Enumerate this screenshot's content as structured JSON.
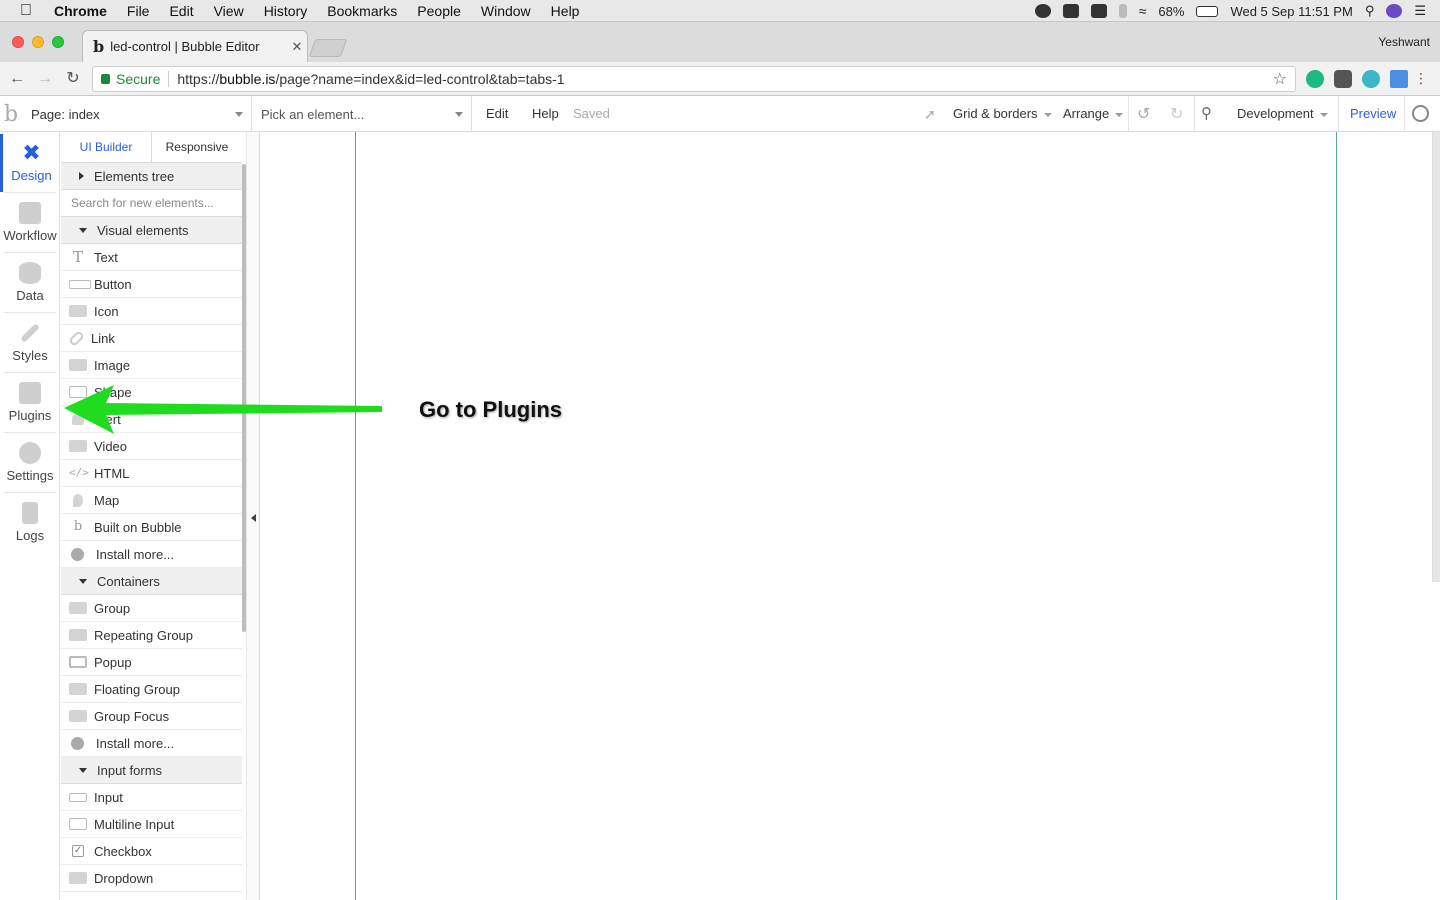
{
  "menubar": {
    "app": "Chrome",
    "items": [
      "File",
      "Edit",
      "View",
      "History",
      "Bookmarks",
      "People",
      "Window",
      "Help"
    ],
    "battery": "68%",
    "datetime": "Wed 5 Sep  11:51 PM"
  },
  "browser": {
    "tab_title": "led-control | Bubble Editor",
    "tab_favicon": "b",
    "profile_name": "Yeshwant",
    "secure_label": "Secure",
    "url_scheme": "https://",
    "url_host": "bubble.is",
    "url_path": "/page?name=index&id=led-control&tab=tabs-1"
  },
  "editor_header": {
    "logo": "b",
    "page_selector": "Page: index",
    "element_picker_placeholder": "Pick an element...",
    "edit": "Edit",
    "help": "Help",
    "status": "Saved",
    "grid_borders": "Grid & borders",
    "arrange": "Arrange",
    "environment": "Development",
    "preview": "Preview"
  },
  "rail": [
    {
      "label": "Design",
      "icon": "design-icon",
      "active": true
    },
    {
      "label": "Workflow",
      "icon": "workflow-icon"
    },
    {
      "label": "Data",
      "icon": "database-icon"
    },
    {
      "label": "Styles",
      "icon": "brush-icon"
    },
    {
      "label": "Plugins",
      "icon": "plugins-icon"
    },
    {
      "label": "Settings",
      "icon": "gear-icon"
    },
    {
      "label": "Logs",
      "icon": "document-icon"
    }
  ],
  "panel": {
    "tabs": [
      "UI Builder",
      "Responsive"
    ],
    "elements_tree": "Elements tree",
    "search_placeholder": "Search for new elements...",
    "sections": [
      {
        "title": "Visual elements",
        "items": [
          "Text",
          "Button",
          "Icon",
          "Link",
          "Image",
          "Shape",
          "Alert",
          "Video",
          "HTML",
          "Map",
          "Built on Bubble",
          "Install more..."
        ]
      },
      {
        "title": "Containers",
        "items": [
          "Group",
          "Repeating Group",
          "Popup",
          "Floating Group",
          "Group Focus",
          "Install more..."
        ]
      },
      {
        "title": "Input forms",
        "items": [
          "Input",
          "Multiline Input",
          "Checkbox",
          "Dropdown"
        ]
      }
    ]
  },
  "annotation": {
    "text": "Go to Plugins",
    "arrow_color": "#1fdc1f"
  },
  "colors": {
    "accent": "#2b5fd9",
    "secure": "#1a8a3a",
    "page_border": "#5aa0a8"
  }
}
